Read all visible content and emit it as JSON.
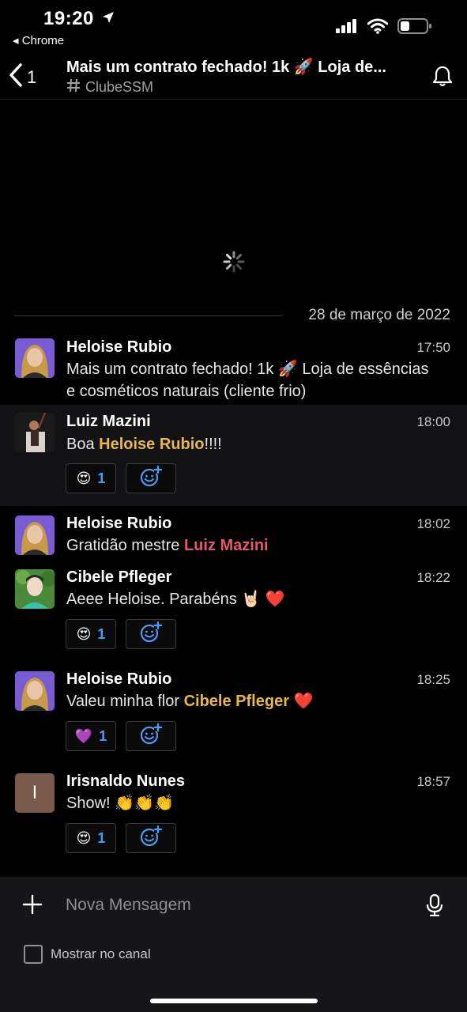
{
  "status_bar": {
    "time": "19:20",
    "back_app": "◂ Chrome"
  },
  "header": {
    "back_count": "1",
    "title": "Mais um contrato fechado! 1k 🚀 Loja de...",
    "channel": "ClubeSSM"
  },
  "date_divider": "28 de março de 2022",
  "messages": [
    {
      "name": "Heloise Rubio",
      "time": "17:50",
      "text": "Mais um contrato fechado! 1k 🚀 Loja de essências e cosméticos naturais (cliente frio)"
    },
    {
      "name": "Luiz Mazini",
      "time": "18:00",
      "text_prefix": "Boa ",
      "mention": "Heloise Rubio",
      "text_suffix": "!!!!",
      "reaction": {
        "emoji": "😍",
        "count": "1"
      }
    },
    {
      "name": "Heloise Rubio",
      "time": "18:02",
      "text_prefix": "Gratidão mestre ",
      "mention": "Luiz Mazini"
    },
    {
      "name": "Cibele Pfleger",
      "time": "18:22",
      "text": "Aeee Heloise. Parabéns 🤘🏻 ❤️",
      "reaction": {
        "emoji": "😍",
        "count": "1"
      }
    },
    {
      "name": "Heloise Rubio",
      "time": "18:25",
      "text_prefix": "Valeu minha flor ",
      "mention": "Cibele Pfleger",
      "text_suffix": " ❤️",
      "reaction": {
        "emoji": "💜",
        "count": "1"
      }
    },
    {
      "name": "Irisnaldo Nunes",
      "time": "18:57",
      "avatar_letter": "I",
      "text": "Show! 👏👏👏",
      "reaction": {
        "emoji": "😍",
        "count": "1"
      }
    }
  ],
  "composer": {
    "placeholder": "Nova Mensagem",
    "checkbox_label": "Mostrar no canal"
  },
  "colors": {
    "mention_yellow": "#e8b84a",
    "mention_red": "#e25a6b",
    "reaction_count": "#4c9cf5",
    "irisnaldo_avatar": "#7a5a4a"
  }
}
